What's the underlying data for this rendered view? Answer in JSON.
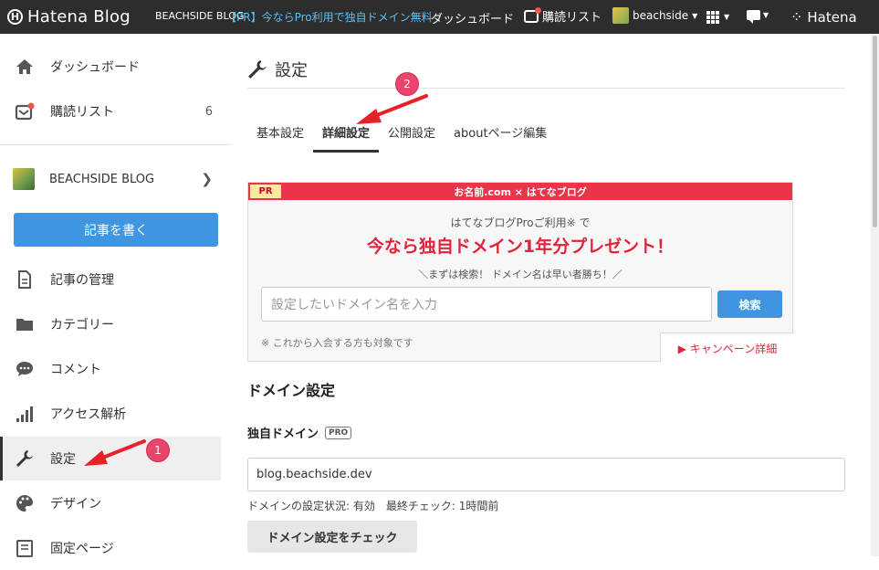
{
  "topbar": {
    "logo_text": "Hatena Blog",
    "logo_mark": "H",
    "blog_name": "BEACHSIDE BLOG",
    "promo": "【PR】今ならPro利用で独自ドメイン無料",
    "dashboard": "ダッシュボード",
    "reading_list": "購読リスト",
    "user": "beachside",
    "hatena": "Hatena"
  },
  "sidebar": {
    "dashboard": "ダッシュボード",
    "reading_list": "購読リスト",
    "reading_count": "6",
    "blog_name": "BEACHSIDE BLOG",
    "write": "記事を書く",
    "articles": "記事の管理",
    "categories": "カテゴリー",
    "comments": "コメント",
    "analytics": "アクセス解析",
    "settings": "設定",
    "design": "デザイン",
    "pages": "固定ページ"
  },
  "main": {
    "title": "設定",
    "tabs": [
      {
        "label": "基本設定"
      },
      {
        "label": "詳細設定"
      },
      {
        "label": "公開設定"
      },
      {
        "label": "aboutページ編集"
      }
    ],
    "pr": {
      "badge": "PR",
      "header": "お名前.com × はてなブログ",
      "sub": "はてなブログProご利用※ で",
      "headline": "今なら独自ドメイン1年分プレゼント！",
      "tagline": "＼まずは検索！ ドメイン名は早い者勝ち！／",
      "input_placeholder": "設定したいドメイン名を入力",
      "search": "検索",
      "note": "※ これから入会する方も対象です",
      "campaign": "▶ キャンペーン詳細"
    },
    "domain": {
      "section_title": "ドメイン設定",
      "label": "独自ドメイン",
      "pro_badge": "PRO",
      "value": "blog.beachside.dev",
      "status": "ドメインの設定状況: 有効　最終チェック: 1時間前",
      "check_button": "ドメイン設定をチェック"
    }
  },
  "annotations": {
    "marker1": "1",
    "marker2": "2",
    "accent": "#e9456d",
    "arrow_color": "#e8202a"
  },
  "colors": {
    "topbar": "#2d2d2d",
    "link_blue": "#5bc0f7",
    "button_blue": "#3f95e0",
    "pr_red": "#e9344a"
  }
}
